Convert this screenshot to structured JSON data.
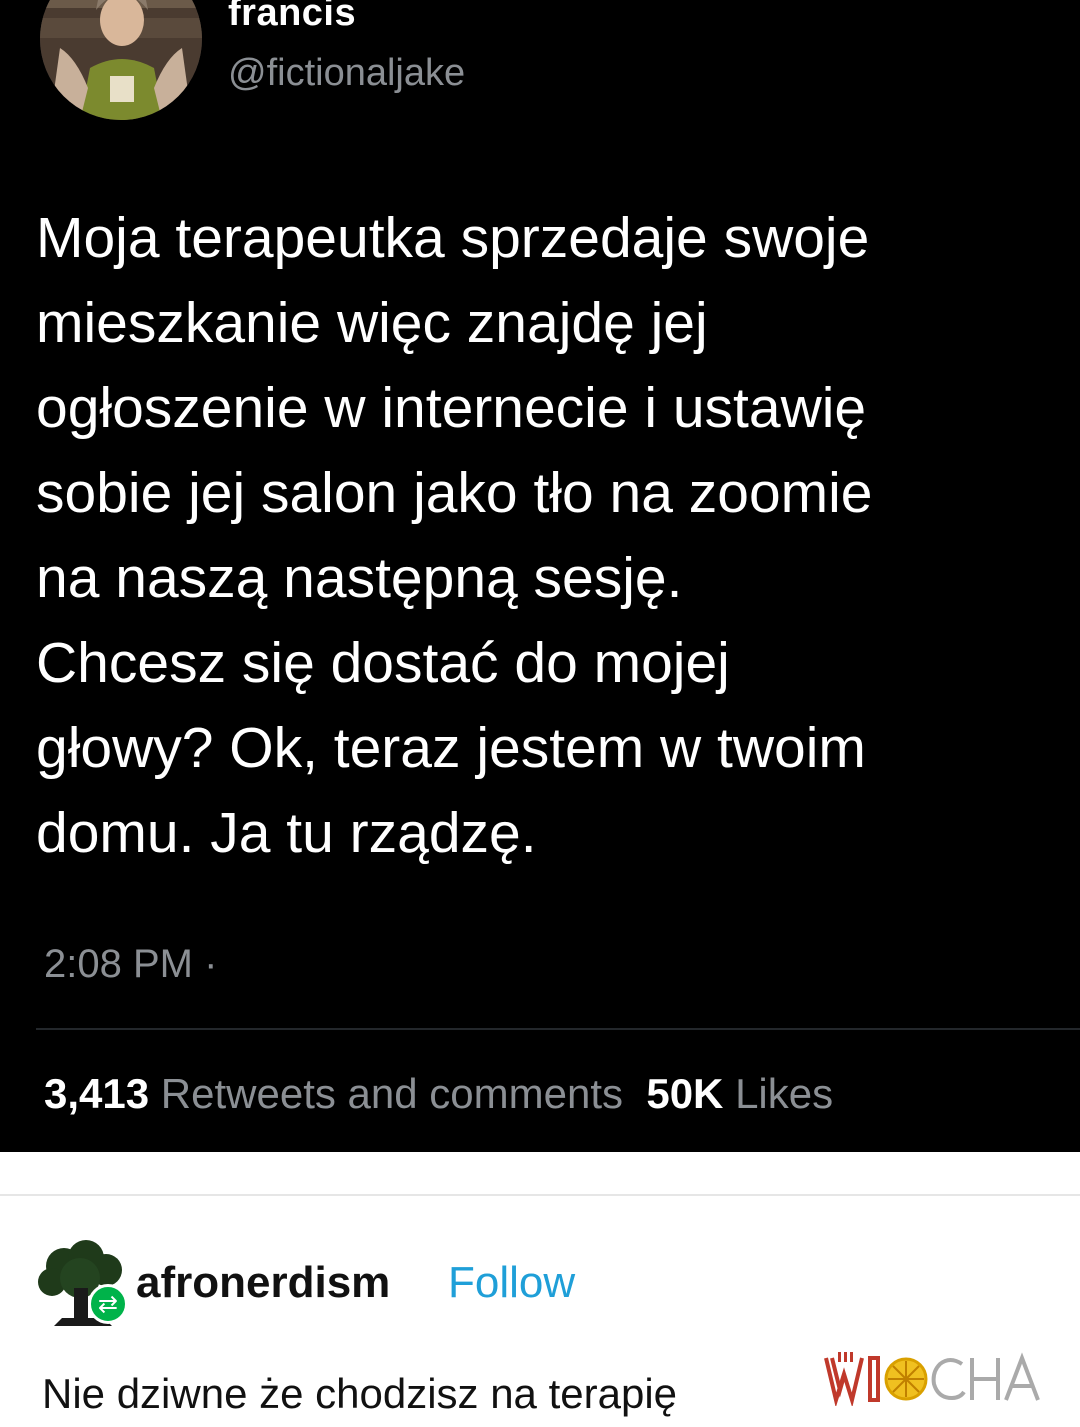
{
  "tweet": {
    "display_name": "francis",
    "handle": "@fictionaljake",
    "text_lines": [
      "Moja terapeutka sprzedaje swoje",
      "mieszkanie więc znajdę jej",
      "ogłoszenie w internecie i ustawię",
      "sobie jej salon jako tło na zoomie",
      "na naszą następną sesję.",
      "Chcesz się dostać do mojej",
      "głowy? Ok, teraz jestem w twoim",
      "domu. Ja tu rządzę."
    ],
    "timestamp": "2:08 PM ·",
    "retweets_count": "3,413",
    "retweets_label": "Retweets and comments",
    "likes_count": "50K",
    "likes_label": "Likes"
  },
  "reply": {
    "username": "afronerdism",
    "follow_label": "Follow",
    "text": "Nie dziwne że chodzisz na terapię",
    "reblog_icon": "reblog-icon"
  },
  "watermark": {
    "text": "WIOCHA"
  },
  "colors": {
    "tweet_bg": "#000000",
    "muted_text": "#8b8f94",
    "follow_blue": "#1f9fd8",
    "reblog_green": "#00b34a",
    "watermark_red": "#c0392b"
  }
}
